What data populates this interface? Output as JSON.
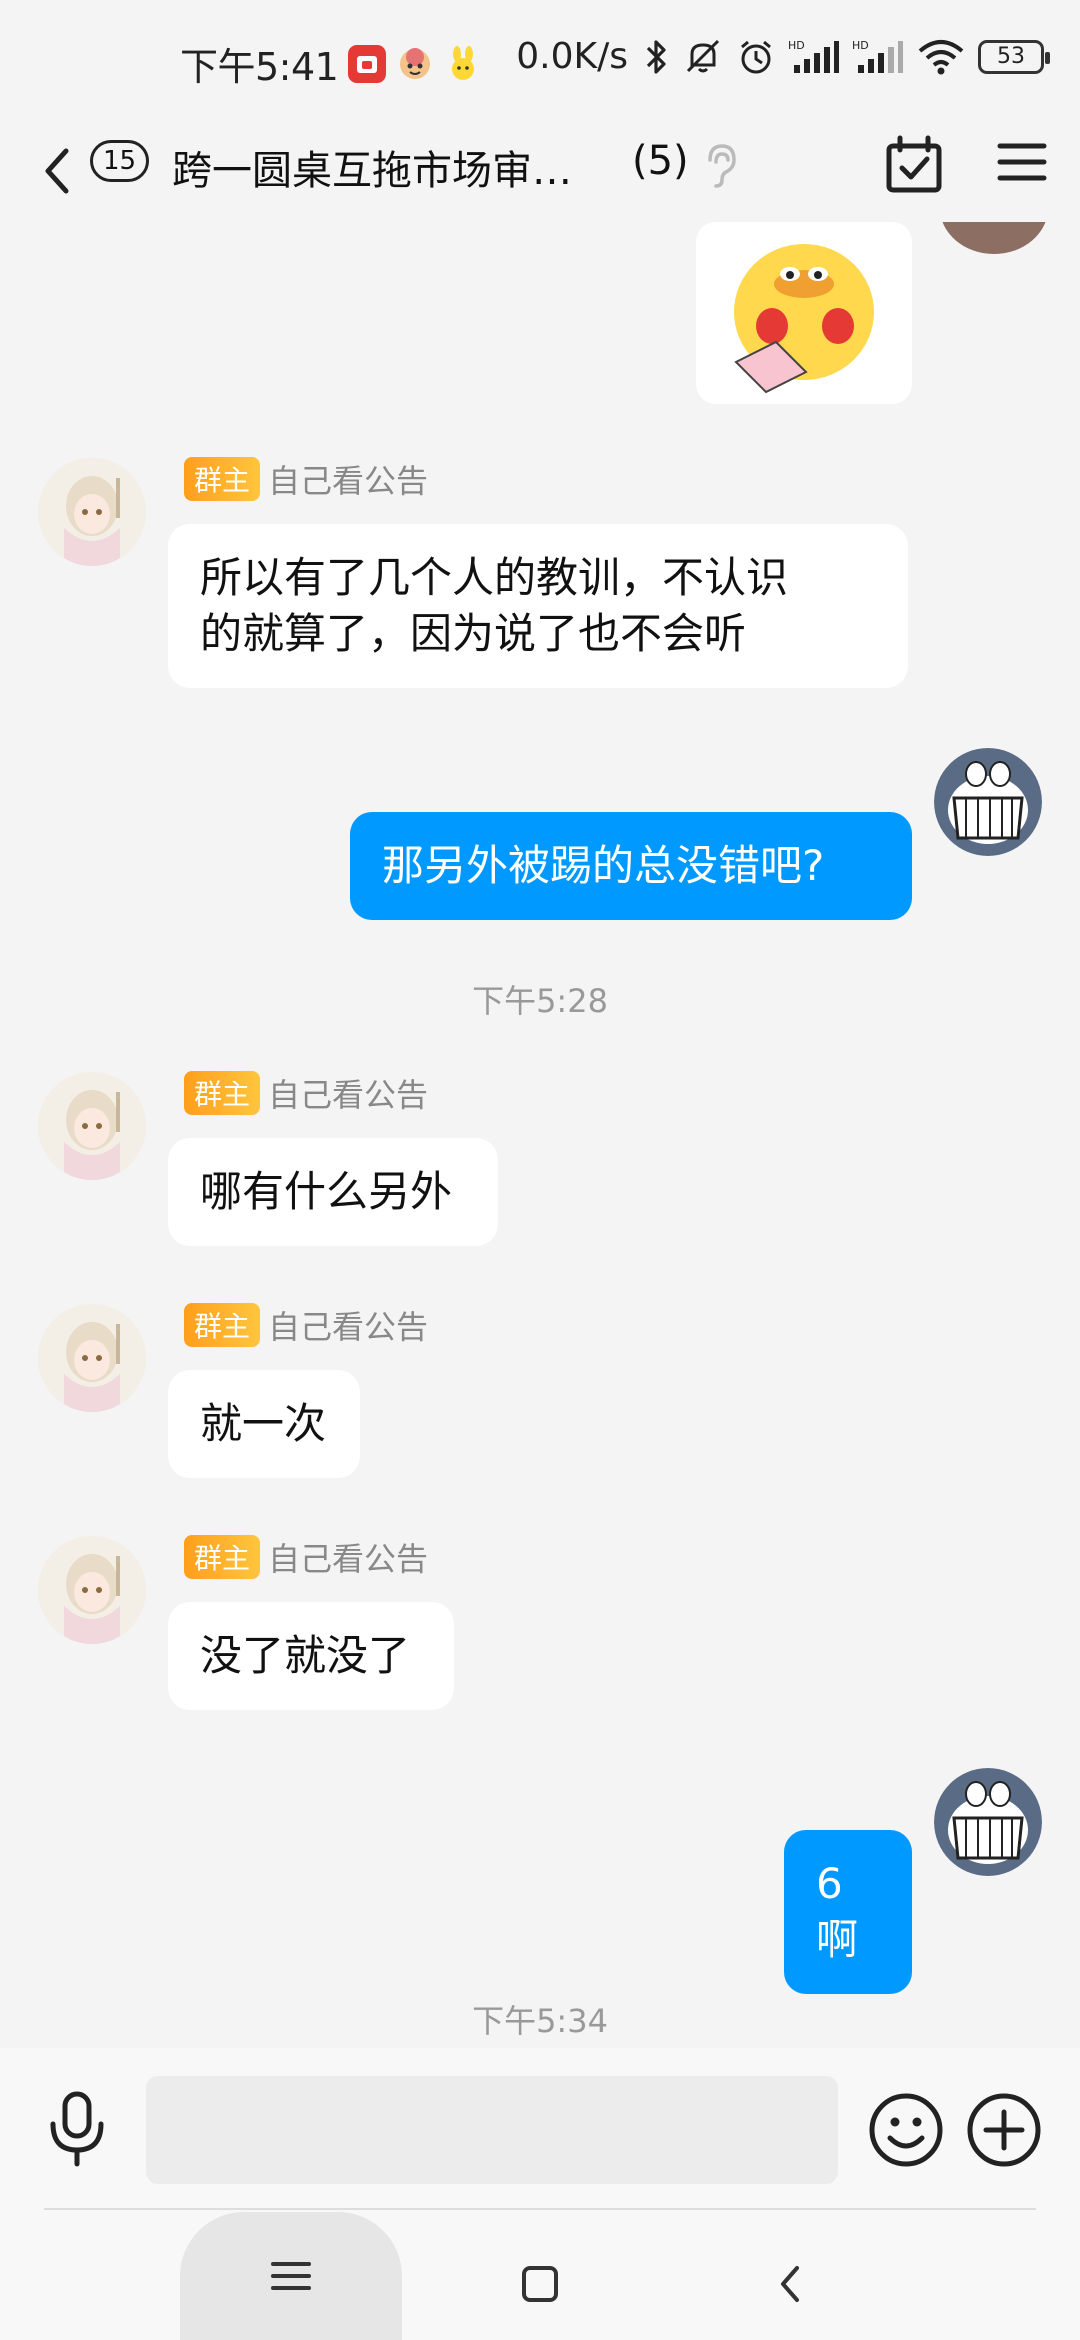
{
  "status_bar": {
    "time": "下午5:41",
    "net_speed": "0.0K/s",
    "battery": "53"
  },
  "header": {
    "unread_count": "15",
    "title": "跨一圆桌互拖市场审…",
    "member_count": "(5)"
  },
  "messages": [
    {
      "side": "left",
      "role": "群主",
      "name": "自己看公告",
      "lines": [
        "所以有了几个人的教训，不认识",
        "的就算了，因为说了也不会听"
      ]
    },
    {
      "side": "right",
      "text": "那另外被踢的总没错吧?"
    },
    {
      "type": "time",
      "text": "下午5:28"
    },
    {
      "side": "left",
      "role": "群主",
      "name": "自己看公告",
      "text": "哪有什么另外"
    },
    {
      "side": "left",
      "role": "群主",
      "name": "自己看公告",
      "text": "就一次"
    },
    {
      "side": "left",
      "role": "群主",
      "name": "自己看公告",
      "text": "没了就没了"
    },
    {
      "side": "right",
      "text": "6啊"
    },
    {
      "type": "time",
      "text": "下午5:34"
    }
  ],
  "input": {
    "placeholder": ""
  },
  "colors": {
    "accent": "#0099ff",
    "background": "#f4f4f4",
    "badge": "#ffb020"
  },
  "icons": [
    "back-icon",
    "ear-icon",
    "calendar-check-icon",
    "menu-icon",
    "mic-icon",
    "emoji-icon",
    "plus-icon"
  ]
}
